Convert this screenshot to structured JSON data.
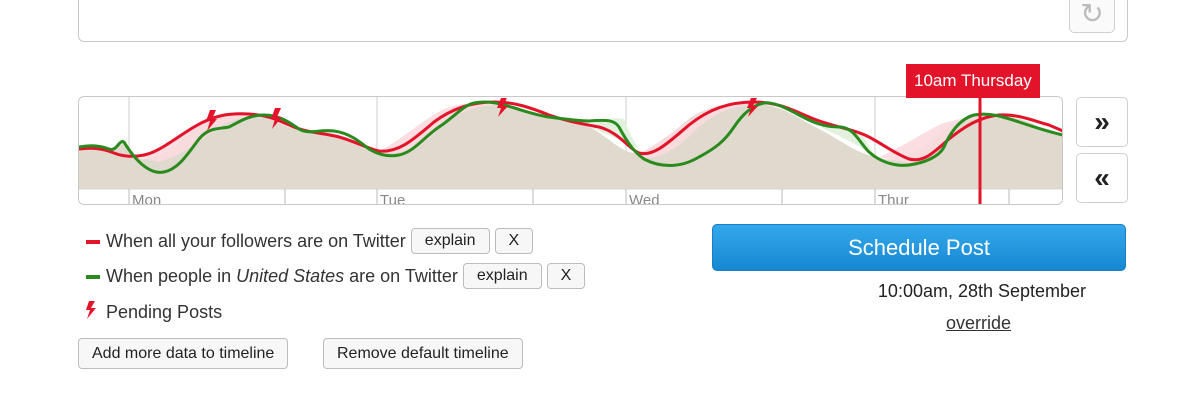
{
  "composer": {
    "refresh_icon": "refresh-icon"
  },
  "timeline": {
    "marker_label": "10am Thursday",
    "days": [
      "Mon",
      "Tue",
      "Wed",
      "Thur"
    ],
    "next_label": "»",
    "prev_label": "«"
  },
  "legend": {
    "followers_text": "When all your followers are on Twitter",
    "us_text_before": "When people in ",
    "us_text_country": "United States",
    "us_text_after": " are on Twitter",
    "explain_label": "explain",
    "remove_label": "X",
    "pending_label": "Pending Posts",
    "colors": {
      "followers": "#e3132a",
      "us": "#2a8a1e"
    }
  },
  "actions": {
    "add_label": "Add more data to timeline",
    "remove_label": "Remove default timeline"
  },
  "schedule": {
    "button_label": "Schedule Post",
    "time_text": "10:00am, 28th September",
    "override_label": "override"
  }
}
